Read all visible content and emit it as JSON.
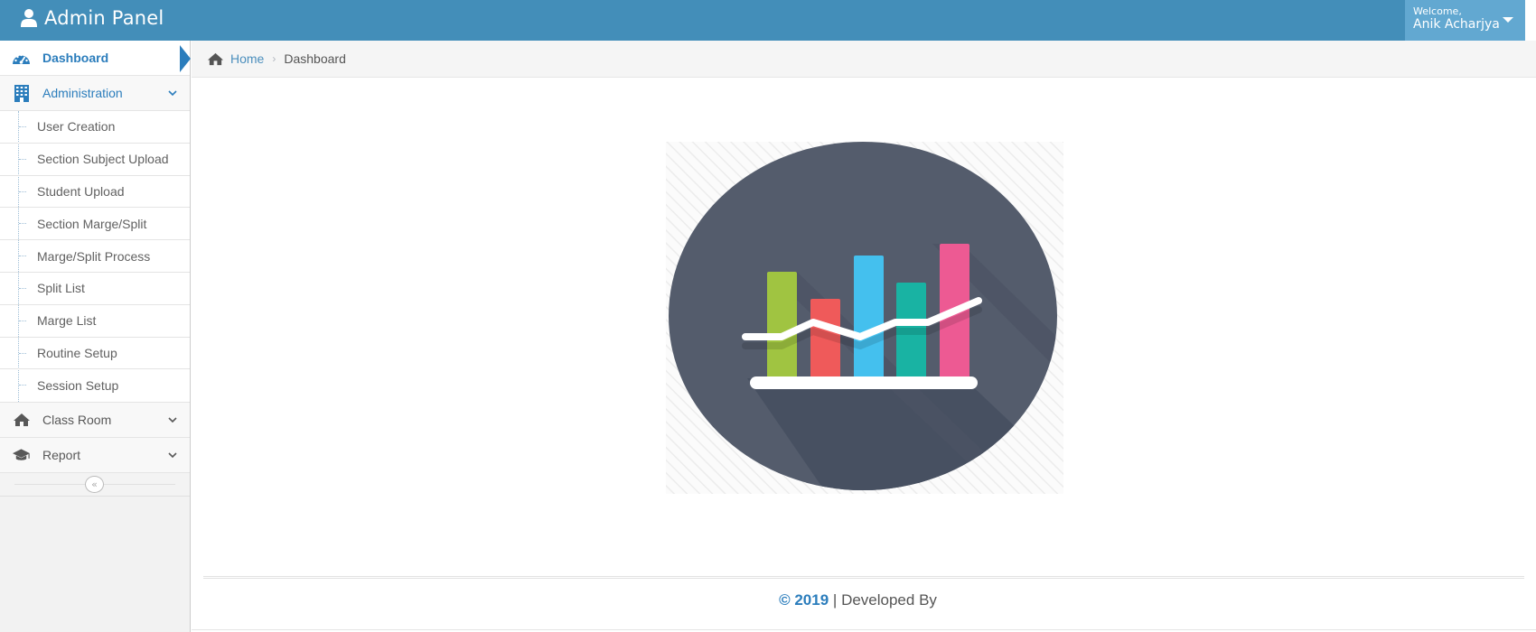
{
  "navbar": {
    "brand_title": "Admin Panel",
    "brand_icon": "user-icon",
    "welcome_label": "Welcome,",
    "user_name": "Anik Acharjya",
    "background_color": "#438eb9",
    "user_menu_color": "#62a8d1"
  },
  "sidebar": {
    "items": [
      {
        "label": "Dashboard",
        "icon": "tachometer-icon",
        "active": true
      },
      {
        "label": "Administration",
        "icon": "building-icon",
        "expanded": true,
        "children": [
          "User Creation",
          "Section Subject Upload",
          "Student Upload",
          "Section Marge/Split",
          "Marge/Split Process",
          "Split List",
          "Marge List",
          "Routine Setup",
          "Session Setup"
        ]
      },
      {
        "label": "Class Room",
        "icon": "home-icon",
        "expanded": false
      },
      {
        "label": "Report",
        "icon": "graduation-cap-icon",
        "expanded": false
      }
    ],
    "collapse_icon": "double-angle-left-icon",
    "accent_color": "#2b7dbc"
  },
  "breadcrumb": {
    "home_label": "Home",
    "current_label": "Dashboard"
  },
  "main": {
    "illustration": "bar-chart-illustration",
    "illustration_colors": [
      "#a0c441",
      "#ef5a5a",
      "#44c0ee",
      "#19b3a3",
      "#ed5a93"
    ],
    "circle_color": "#545c6c"
  },
  "footer": {
    "year_text": "© 2019",
    "separator": "|",
    "developed_text": "Developed By"
  }
}
